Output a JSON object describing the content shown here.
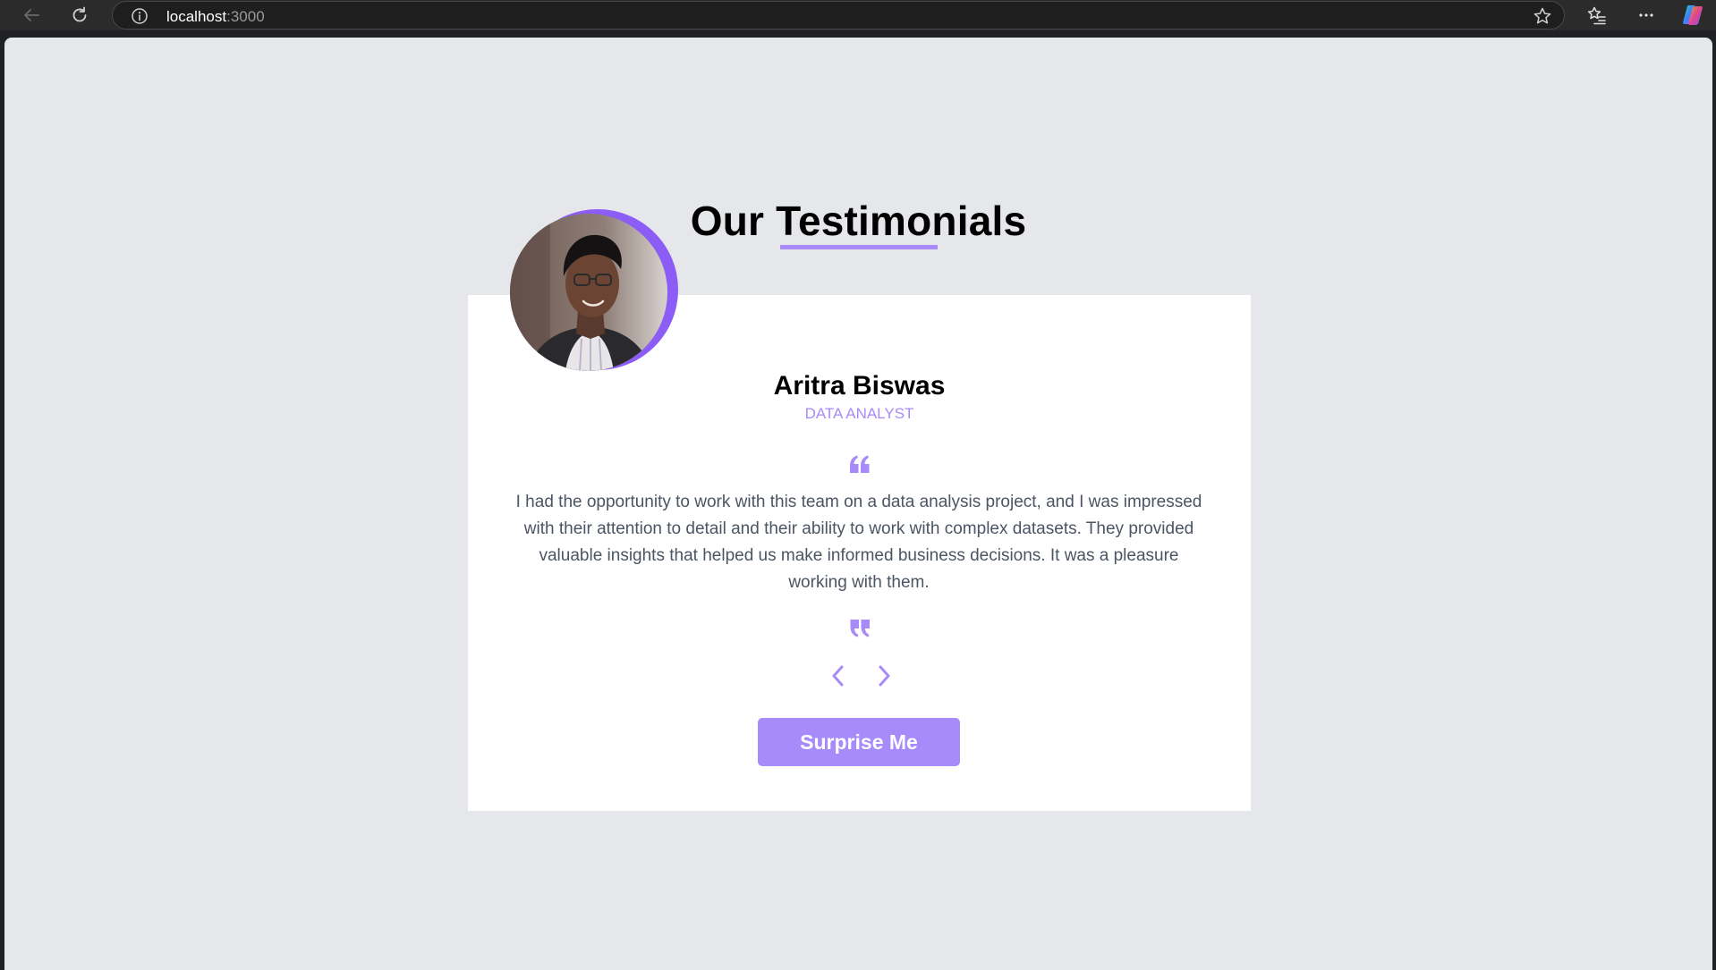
{
  "browser": {
    "url_host": "localhost",
    "url_port": ":3000",
    "icons": {
      "back": "arrow-left-icon",
      "reload": "reload-icon",
      "site_info": "info-icon",
      "favorite": "star-icon",
      "favorites_list": "favorites-icon",
      "more": "more-icon",
      "copilot": "copilot-icon"
    }
  },
  "page": {
    "title": "Our Testimonials",
    "accent_color": "#a78bfa",
    "background_color": "#e5e7eb"
  },
  "testimonial": {
    "name": "Aritra Biswas",
    "job": "DATA ANALYST",
    "text": "I had the opportunity to work with this team on a data analysis project, and I was impressed with their attention to detail and their ability to work with complex datasets. They provided valuable insights that helped us make informed business decisions. It was a pleasure working with them.",
    "avatar_icon": "person-photo"
  },
  "controls": {
    "prev_icon": "chevron-left-icon",
    "next_icon": "chevron-right-icon",
    "surprise_label": "Surprise Me"
  }
}
